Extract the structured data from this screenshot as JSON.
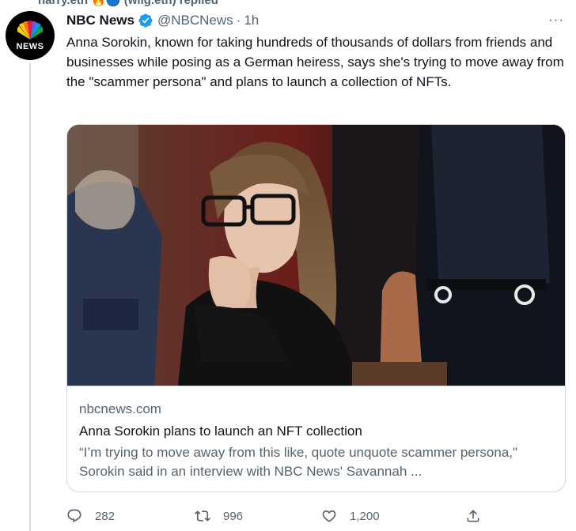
{
  "context": {
    "text": "harry.eth 🔥🔵 (wilg.eth) replied"
  },
  "tweet": {
    "display_name": "NBC News",
    "handle": "@NBCNews",
    "separator": "·",
    "time": "1h",
    "avatar_text": "NEWS",
    "more_glyph": "···",
    "text": "Anna Sorokin, known for taking hundreds of thousands of dollars from friends and businesses while posing as a German heiress, says she's trying to move away from the \"scammer persona\" and plans to launch a collection of NFTs."
  },
  "card": {
    "domain": "nbcnews.com",
    "title": "Anna Sorokin plans to launch an NFT collection",
    "description": "“I’m trying to move away from this like, quote unquote scammer persona,\" Sorokin said in an interview with NBC News' Savannah ..."
  },
  "actions": {
    "reply_count": "282",
    "retweet_count": "996",
    "like_count": "1,200"
  },
  "icons": {
    "verified": "verified-badge-icon",
    "reply": "reply-icon",
    "retweet": "retweet-icon",
    "like": "heart-icon",
    "share": "share-icon",
    "more": "more-icon"
  },
  "colors": {
    "text_primary": "#0f1419",
    "text_secondary": "#536471",
    "verified_blue": "#1d9bf0",
    "border": "#cfd9de"
  }
}
